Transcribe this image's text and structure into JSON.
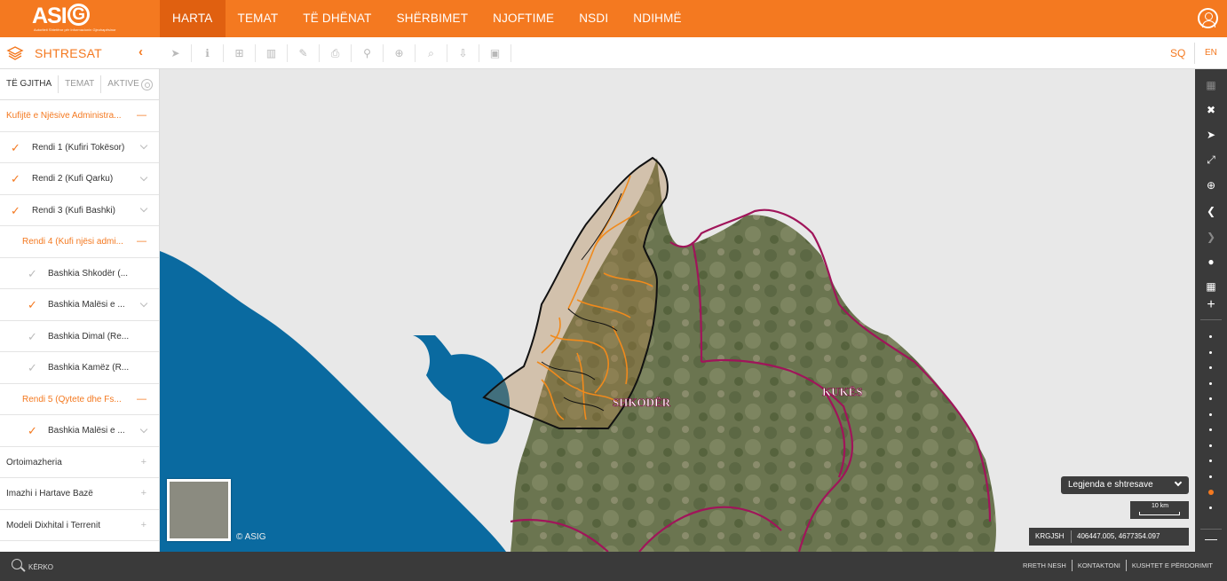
{
  "header": {
    "logo_text": "ASIG",
    "logo_tagline": "Autoriteti Shtetëror për Informacionin Gjeohapësinor",
    "nav": [
      {
        "label": "HARTA",
        "active": true
      },
      {
        "label": "TEMAT"
      },
      {
        "label": "TË DHËNAT"
      },
      {
        "label": "SHËRBIMET"
      },
      {
        "label": "NJOFTIME"
      },
      {
        "label": "NSDI"
      },
      {
        "label": "NDIHMË"
      }
    ],
    "user_icon": "user-icon"
  },
  "toolbar": {
    "layers_title": "SHTRESAT",
    "collapse_glyph": "‹",
    "tools": [
      "select-icon",
      "info-icon",
      "add-icon",
      "chart-icon",
      "edit-icon",
      "print-icon",
      "link-icon",
      "circle-plus-icon",
      "search-icon",
      "download-icon",
      "image-icon"
    ],
    "lang_sq": "SQ",
    "lang_en": "EN"
  },
  "sidebar": {
    "tabs": [
      "TË GJITHA",
      "TEMAT",
      "AKTIVE"
    ],
    "rows": [
      {
        "label": "Kufijtë e Njësive Administra...",
        "style": "orange",
        "indent": 0,
        "check": "",
        "ctl": "—"
      },
      {
        "label": "Rendi 1 (Kufiri Tokësor)",
        "style": "normal",
        "indent": 1,
        "check": "on",
        "ctl": "chev"
      },
      {
        "label": "Rendi 2 (Kufi Qarku)",
        "style": "normal",
        "indent": 1,
        "check": "on",
        "ctl": "chev"
      },
      {
        "label": "Rendi 3 (Kufi Bashki)",
        "style": "normal",
        "indent": 1,
        "check": "on",
        "ctl": "chev"
      },
      {
        "label": "Rendi 4 (Kufi njësi admi...",
        "style": "orange",
        "indent": 2,
        "check": "",
        "ctl": "—"
      },
      {
        "label": "Bashkia Shkodër (...",
        "style": "normal",
        "indent": 3,
        "check": "off",
        "ctl": ""
      },
      {
        "label": "Bashkia Malësi e ...",
        "style": "normal",
        "indent": 3,
        "check": "on",
        "ctl": "chev"
      },
      {
        "label": "Bashkia Dimal (Re...",
        "style": "normal",
        "indent": 3,
        "check": "off",
        "ctl": ""
      },
      {
        "label": "Bashkia Kamëz (R...",
        "style": "normal",
        "indent": 3,
        "check": "off",
        "ctl": ""
      },
      {
        "label": "Rendi 5 (Qytete dhe Fs...",
        "style": "orange",
        "indent": 2,
        "check": "",
        "ctl": "—"
      },
      {
        "label": "Bashkia Malësi e ...",
        "style": "normal",
        "indent": 3,
        "check": "on",
        "ctl": "chev"
      },
      {
        "label": "Ortoimazheria",
        "style": "normal",
        "indent": 0,
        "check": "",
        "ctl": "+"
      },
      {
        "label": "Imazhi i Hartave Bazë",
        "style": "normal",
        "indent": 0,
        "check": "",
        "ctl": "+"
      },
      {
        "label": "Modeli Dixhital i Terrenit",
        "style": "normal",
        "indent": 0,
        "check": "",
        "ctl": "+"
      }
    ]
  },
  "map": {
    "labels": {
      "shkoder": "SHKODËR",
      "kukes": "KUKËS"
    },
    "copyright": "© ASIG",
    "legend_button": "Legjenda e shtresave",
    "scale_label": "10 km",
    "crs": "KRGJSH",
    "coordinates": "406447.005, 4677354.097",
    "colors": {
      "sea": "#0a6aa0",
      "border": "#a0155a",
      "admin": "#f08a1c",
      "accent": "#f47920"
    }
  },
  "rail": {
    "buttons": [
      "map-icon",
      "fullscreen-icon",
      "locate-icon",
      "expand-icon",
      "zoom-icon",
      "back-icon",
      "forward-icon",
      "globe-icon",
      "grid-icon",
      "plus-icon",
      "minus-icon"
    ],
    "zoom_level_active": 10
  },
  "footer": {
    "search_label": "KËRKO",
    "links": [
      "RRETH NESH",
      "KONTAKTONI",
      "KUSHTET E PËRDORIMIT"
    ]
  }
}
